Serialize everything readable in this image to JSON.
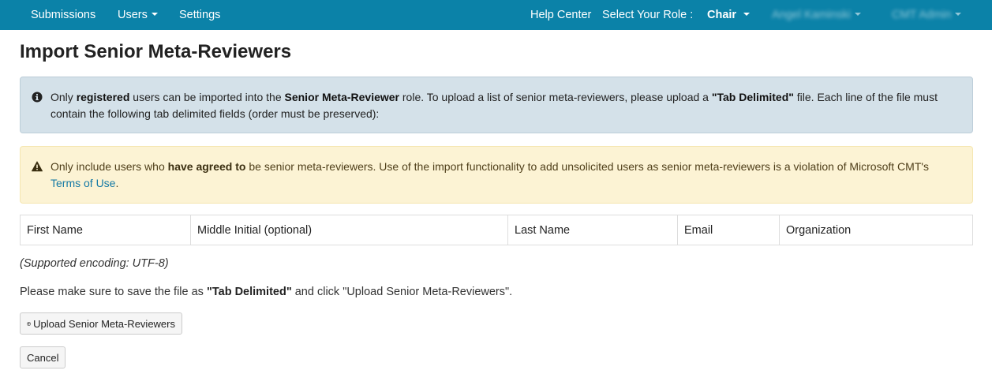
{
  "navbar": {
    "submissions_label": "Submissions",
    "users_label": "Users",
    "settings_label": "Settings",
    "help_center_label": "Help Center",
    "select_role_label": "Select Your Role :",
    "role_value": "Chair",
    "user_name_blurred": "Angel Kaminski",
    "account_blurred": "CMT Admin"
  },
  "page": {
    "title": "Import Senior Meta-Reviewers"
  },
  "info_alert": {
    "icon": "info-circle-icon",
    "t1": "Only ",
    "b1": "registered",
    "t2": " users can be imported into the ",
    "b2": "Senior Meta-Reviewer",
    "t3": " role. To upload a list of senior meta-reviewers, please upload a ",
    "b3": "\"Tab Delimited\"",
    "t4": " file. Each line of the file must contain the following tab delimited fields (order must be preserved):"
  },
  "warning_alert": {
    "icon": "warning-triangle-icon",
    "t1": "Only include users who ",
    "b1": "have agreed to",
    "t2": " be senior meta-reviewers. Use of the import functionality to add unsolicited users as senior meta-reviewers is a violation of Microsoft CMT's ",
    "link": "Terms of Use",
    "t3": "."
  },
  "fields": [
    "First Name",
    "Middle Initial (optional)",
    "Last Name",
    "Email",
    "Organization"
  ],
  "encoding_note": "(Supported encoding: UTF-8)",
  "instructions": {
    "t1": "Please make sure to save the file as ",
    "b1": "\"Tab Delimited\"",
    "t2": " and click \"Upload Senior Meta-Reviewers\"."
  },
  "buttons": {
    "upload_label": "Upload Senior Meta-Reviewers",
    "upload_icon": "upload-circle-icon",
    "cancel_label": "Cancel"
  },
  "colors": {
    "navbar": "#0b82a8",
    "info_bg": "#d4e1e9",
    "warning_bg": "#fcf3d4",
    "link": "#1479a5"
  }
}
